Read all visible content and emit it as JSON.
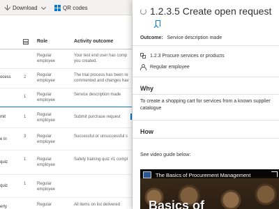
{
  "toolbar": {
    "download_label": "Download",
    "qr_label": "QR codes"
  },
  "table": {
    "columns": {
      "role": "Role",
      "outcome": "Activity outcome"
    },
    "rows": [
      {
        "process": "",
        "num": "",
        "role": "Regular employee",
        "outcome": "Your test end user has comp you created."
      },
      {
        "process": "ocess",
        "num": "2",
        "role": "Regular employee",
        "outcome": "The trial process has been re commented and changes hav"
      },
      {
        "process": "",
        "num": "1",
        "role": "Regular employee",
        "outcome": "Service description made"
      },
      {
        "process": "mit",
        "num": "1",
        "role": "Regular employee",
        "outcome": "Submit purchase request"
      },
      {
        "process": "e in",
        "num": "3",
        "role": "Regular employee",
        "outcome": "Successful or unsuccessful s"
      },
      {
        "process": "quiz",
        "num": "1",
        "role": "Regular employee",
        "outcome": "Safety training quiz #1 compl"
      },
      {
        "process": "quiz",
        "num": "1",
        "role": "Regular employee",
        "outcome": ""
      },
      {
        "process": "erty",
        "num": "",
        "role": "Regular",
        "outcome": "All items on list delivered"
      }
    ]
  },
  "panel": {
    "title": "1.2.3.5 Create open request",
    "outcome_label": "Outcome:",
    "outcome_value": "Service description made",
    "parent_process": "1.2.3 Procure services or products",
    "role": "Regular employee",
    "why_heading": "Why",
    "why_text": "To create a shopping cart for services from a known supplier catalogue",
    "how_heading": "How",
    "how_text": "See video guide below:",
    "video_title": "The Basics of Procurement Management",
    "video_overlay_text": "Basics of"
  }
}
